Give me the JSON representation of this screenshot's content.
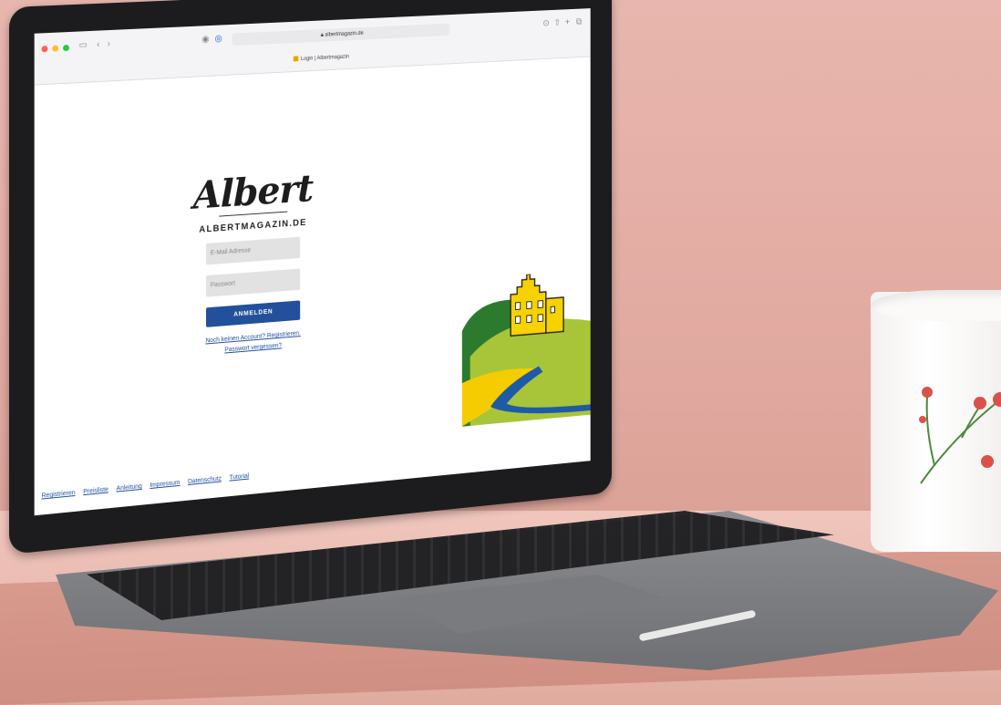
{
  "browser": {
    "url": "albertmagazin.de",
    "tab_title": "Login | Albertmagazin"
  },
  "login": {
    "logo_text": "Albert",
    "site_name": "ALBERTMAGAZIN.DE",
    "email_placeholder": "E-Mail Adresse",
    "password_placeholder": "Passwort",
    "submit_label": "ANMELDEN",
    "register_link": "Noch keinen Account? Registrieren.",
    "forgot_link": "Passwort vergessen?"
  },
  "footer": {
    "links": [
      "Registrieren",
      "Preisliste",
      "Anleitung",
      "Impressum",
      "Datenschutz",
      "Tutorial"
    ]
  },
  "colors": {
    "button": "#22509a",
    "link": "#1f4fa0",
    "hill_dark": "#2c7a2e",
    "hill_light": "#a8c53a",
    "field_yellow": "#f5cc00",
    "river": "#1f5aa6",
    "castle": "#f5d200"
  },
  "icons": [
    "sidebar-icon",
    "back-arrow-icon",
    "forward-arrow-icon",
    "shield-icon",
    "lock-icon",
    "share-icon",
    "new-tab-icon",
    "tabs-icon",
    "download-icon"
  ]
}
